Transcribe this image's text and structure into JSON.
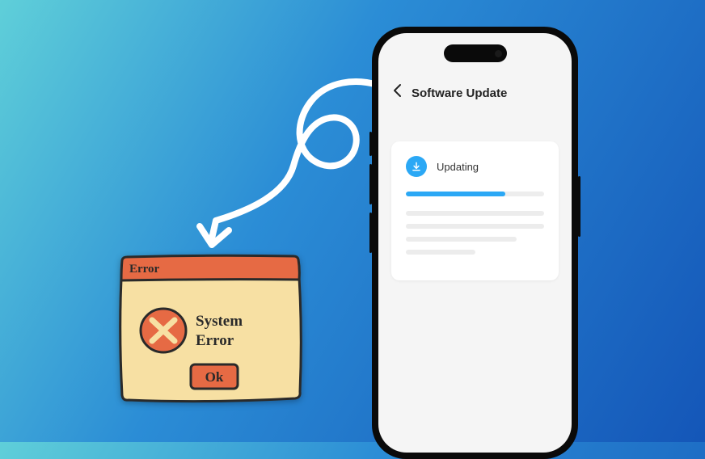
{
  "phone": {
    "header_title": "Software Update",
    "card_title": "Updating",
    "progress_percent": 72
  },
  "error_dialog": {
    "titlebar": "Error",
    "message_line1": "System",
    "message_line2": "Error",
    "button_label": "Ok"
  },
  "colors": {
    "accent_blue": "#2ba8f5",
    "dialog_red": "#e66a44",
    "dialog_yellow": "#f7e0a3"
  }
}
